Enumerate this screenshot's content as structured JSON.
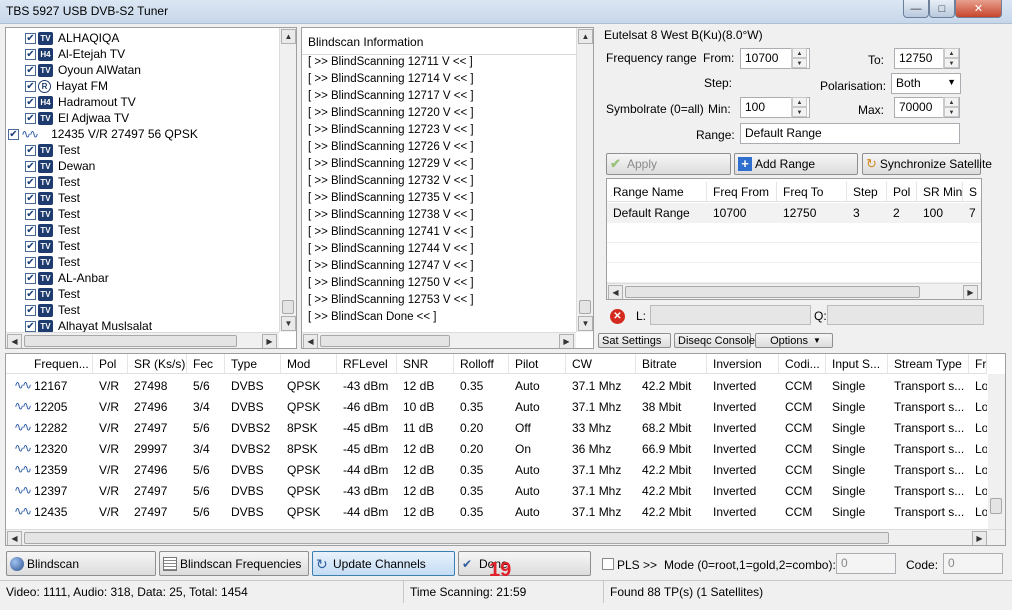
{
  "window": {
    "title": "TBS 5927 USB DVB-S2 Tuner"
  },
  "tree": {
    "rows": [
      {
        "kind": "tv",
        "icon": "TV",
        "label": "ALHAQIQA"
      },
      {
        "kind": "tv",
        "icon": "H4",
        "label": "Al-Etejah TV"
      },
      {
        "kind": "tv",
        "icon": "TV",
        "label": "Oyoun AlWatan"
      },
      {
        "kind": "radio",
        "icon": "R",
        "label": "Hayat FM"
      },
      {
        "kind": "tv",
        "icon": "H4",
        "label": "Hadramout TV"
      },
      {
        "kind": "tv",
        "icon": "TV",
        "label": "El Adjwaa TV"
      },
      {
        "kind": "tp",
        "icon": "",
        "label": "12435 V/R 27497 56 QPSK"
      },
      {
        "kind": "tv",
        "icon": "TV",
        "label": "Test"
      },
      {
        "kind": "tv",
        "icon": "TV",
        "label": "Dewan"
      },
      {
        "kind": "tv",
        "icon": "TV",
        "label": "Test"
      },
      {
        "kind": "tv",
        "icon": "TV",
        "label": "Test"
      },
      {
        "kind": "tv",
        "icon": "TV",
        "label": "Test"
      },
      {
        "kind": "tv",
        "icon": "TV",
        "label": "Test"
      },
      {
        "kind": "tv",
        "icon": "TV",
        "label": "Test"
      },
      {
        "kind": "tv",
        "icon": "TV",
        "label": "Test"
      },
      {
        "kind": "tv",
        "icon": "TV",
        "label": "AL-Anbar"
      },
      {
        "kind": "tv",
        "icon": "TV",
        "label": "Test"
      },
      {
        "kind": "tv",
        "icon": "TV",
        "label": "Test"
      },
      {
        "kind": "tv",
        "icon": "TV",
        "label": "Alhayat Muslsalat"
      }
    ]
  },
  "blindscan": {
    "header": "Blindscan Information",
    "lines": [
      "[ >> BlindScanning 12711 V << ]",
      "[ >> BlindScanning 12714 V << ]",
      "[ >> BlindScanning 12717 V << ]",
      "[ >> BlindScanning 12720 V << ]",
      "[ >> BlindScanning 12723 V << ]",
      "[ >> BlindScanning 12726 V << ]",
      "[ >> BlindScanning 12729 V << ]",
      "[ >> BlindScanning 12732 V << ]",
      "[ >> BlindScanning 12735 V << ]",
      "[ >> BlindScanning 12738 V << ]",
      "[ >> BlindScanning 12741 V << ]",
      "[ >> BlindScanning 12744 V << ]",
      "[ >> BlindScanning 12747 V << ]",
      "[ >> BlindScanning 12750 V << ]",
      "[ >> BlindScanning 12753 V << ]",
      "[ >> BlindScan Done << ]"
    ]
  },
  "settings": {
    "satellite": "Eutelsat 8 West B(Ku)(8.0°W)",
    "freq_range_label": "Frequency range",
    "from_label": "From:",
    "from_value": "10700",
    "to_label": "To:",
    "to_value": "12750",
    "step_label": "Step:",
    "polarisation_label": "Polarisation:",
    "polarisation_value": "Both",
    "symbolrate_label": "Symbolrate (0=all)",
    "min_label": "Min:",
    "min_value": "100",
    "max_label": "Max:",
    "max_value": "70000",
    "range_label": "Range:",
    "range_value": "Default Range",
    "apply": "Apply",
    "add_range": "Add Range",
    "sync_sat": "Synchronize Satellite",
    "range_table": {
      "headers": [
        "Range Name",
        "Freq From",
        "Freq To",
        "Step",
        "Pol",
        "SR Min",
        "S"
      ],
      "rows": [
        [
          "Default Range",
          "10700",
          "12750",
          "3",
          "2",
          "100",
          "7"
        ]
      ]
    },
    "l_label": "L:",
    "q_label": "Q:",
    "sat_settings": "Sat Settings",
    "diseqc_console": "Diseqc Console",
    "options": "Options"
  },
  "results": {
    "headers": [
      "Frequen...",
      "Pol",
      "SR (Ks/s)",
      "Fec",
      "Type",
      "Mod",
      "RFLevel",
      "SNR",
      "Rolloff",
      "Pilot",
      "CW",
      "Bitrate",
      "Inversion",
      "Codi...",
      "Input S...",
      "Stream Type",
      "Fra"
    ],
    "rows": [
      [
        "12167",
        "V/R",
        "27498",
        "5/6",
        "DVBS",
        "QPSK",
        "-43 dBm",
        "12 dB",
        "0.35",
        "Auto",
        "37.1 Mhz",
        "42.2 Mbit",
        "Inverted",
        "CCM",
        "Single",
        "Transport s...",
        "Lo"
      ],
      [
        "12205",
        "V/R",
        "27496",
        "3/4",
        "DVBS",
        "QPSK",
        "-46 dBm",
        "10 dB",
        "0.35",
        "Auto",
        "37.1 Mhz",
        "38 Mbit",
        "Inverted",
        "CCM",
        "Single",
        "Transport s...",
        "Lo"
      ],
      [
        "12282",
        "V/R",
        "27497",
        "5/6",
        "DVBS2",
        "8PSK",
        "-45 dBm",
        "11 dB",
        "0.20",
        "Off",
        "33 Mhz",
        "68.2 Mbit",
        "Inverted",
        "CCM",
        "Single",
        "Transport s...",
        "Lo"
      ],
      [
        "12320",
        "V/R",
        "29997",
        "3/4",
        "DVBS2",
        "8PSK",
        "-45 dBm",
        "12 dB",
        "0.20",
        "On",
        "36 Mhz",
        "66.9 Mbit",
        "Inverted",
        "CCM",
        "Single",
        "Transport s...",
        "Lo"
      ],
      [
        "12359",
        "V/R",
        "27496",
        "5/6",
        "DVBS",
        "QPSK",
        "-44 dBm",
        "12 dB",
        "0.35",
        "Auto",
        "37.1 Mhz",
        "42.2 Mbit",
        "Inverted",
        "CCM",
        "Single",
        "Transport s...",
        "Lo"
      ],
      [
        "12397",
        "V/R",
        "27497",
        "5/6",
        "DVBS",
        "QPSK",
        "-43 dBm",
        "12 dB",
        "0.35",
        "Auto",
        "37.1 Mhz",
        "42.2 Mbit",
        "Inverted",
        "CCM",
        "Single",
        "Transport s...",
        "Lo"
      ],
      [
        "12435",
        "V/R",
        "27497",
        "5/6",
        "DVBS",
        "QPSK",
        "-44 dBm",
        "12 dB",
        "0.35",
        "Auto",
        "37.1 Mhz",
        "42.2 Mbit",
        "Inverted",
        "CCM",
        "Single",
        "Transport s...",
        "Lo"
      ]
    ]
  },
  "toolbar": {
    "blindscan": "Blindscan",
    "blindscan_freqs": "Blindscan Frequencies",
    "update_channels": "Update Channels",
    "done": "Done",
    "overlay_number": "19",
    "pls": "PLS >>",
    "mode_label": "Mode (0=root,1=gold,2=combo):",
    "mode_value": "0",
    "code_label": "Code:",
    "code_value": "0"
  },
  "status": {
    "counts": "Video: 1111, Audio: 318, Data: 25, Total: 1454",
    "time": "Time Scanning: 21:59",
    "found": "Found 88 TP(s) (1 Satellites)"
  },
  "colors": {
    "accent": "#1d3b6e",
    "overlay": "#e0202a",
    "selected_btn": "#d7e8f8"
  }
}
